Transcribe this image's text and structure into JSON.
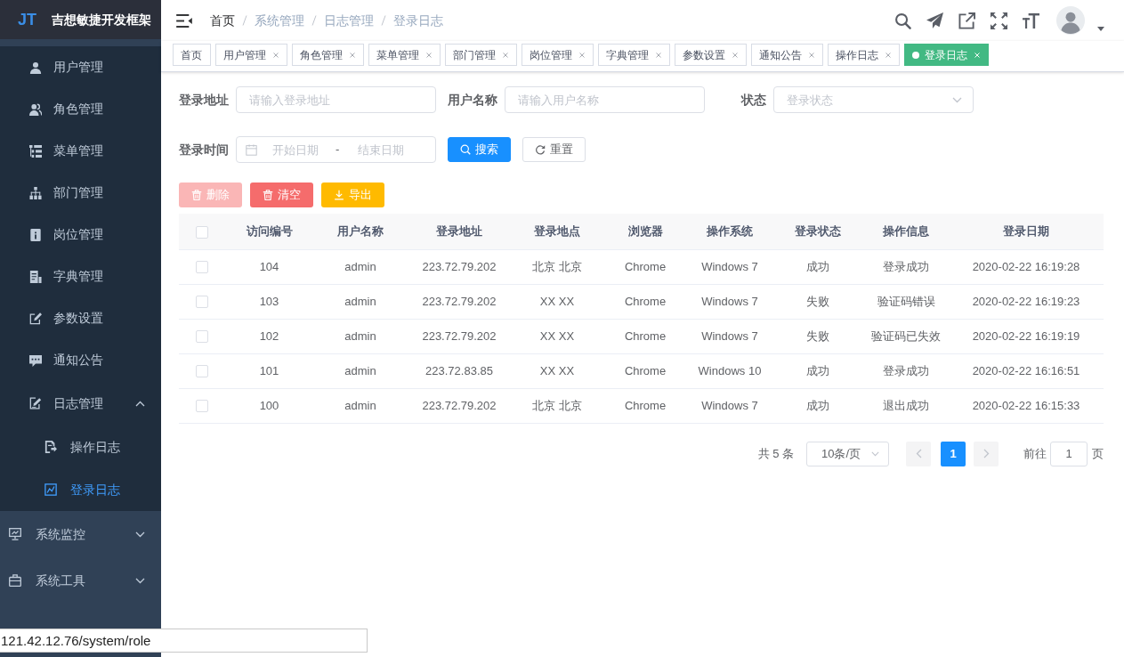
{
  "sidebar": {
    "logo": "JT",
    "title": "吉想敏捷开发框架",
    "submenu_items": [
      {
        "label": "用户管理",
        "kind": "item",
        "selected": false
      },
      {
        "label": "角色管理",
        "kind": "item",
        "selected": false
      },
      {
        "label": "菜单管理",
        "kind": "item",
        "selected": false
      },
      {
        "label": "部门管理",
        "kind": "item",
        "selected": false
      },
      {
        "label": "岗位管理",
        "kind": "item",
        "selected": false
      },
      {
        "label": "字典管理",
        "kind": "item",
        "selected": false
      },
      {
        "label": "参数设置",
        "kind": "item",
        "selected": false
      },
      {
        "label": "通知公告",
        "kind": "item",
        "selected": false
      },
      {
        "label": "日志管理",
        "kind": "group",
        "expanded": true,
        "children": [
          {
            "label": "操作日志",
            "selected": false
          },
          {
            "label": "登录日志",
            "selected": true
          }
        ]
      }
    ],
    "menu_items": [
      {
        "label": "系统监控",
        "expanded": false
      },
      {
        "label": "系统工具",
        "expanded": false
      }
    ]
  },
  "navbar": {
    "breadcrumb": [
      {
        "label": "首页",
        "kind": "link"
      },
      {
        "label": "系统管理",
        "kind": "text"
      },
      {
        "label": "日志管理",
        "kind": "text"
      },
      {
        "label": "登录日志",
        "kind": "text"
      }
    ]
  },
  "tags": [
    {
      "label": "首页",
      "closable": false,
      "selected": false
    },
    {
      "label": "用户管理",
      "closable": true,
      "selected": false
    },
    {
      "label": "角色管理",
      "closable": true,
      "selected": false
    },
    {
      "label": "菜单管理",
      "closable": true,
      "selected": false
    },
    {
      "label": "部门管理",
      "closable": true,
      "selected": false
    },
    {
      "label": "岗位管理",
      "closable": true,
      "selected": false
    },
    {
      "label": "字典管理",
      "closable": true,
      "selected": false
    },
    {
      "label": "参数设置",
      "closable": true,
      "selected": false
    },
    {
      "label": "通知公告",
      "closable": true,
      "selected": false
    },
    {
      "label": "操作日志",
      "closable": true,
      "selected": false
    },
    {
      "label": "登录日志",
      "closable": true,
      "selected": true
    }
  ],
  "search_form": {
    "fields": [
      {
        "label": "登录地址",
        "kind": "input",
        "placeholder": "请输入登录地址"
      },
      {
        "label": "用户名称",
        "kind": "input",
        "placeholder": "请输入用户名称"
      },
      {
        "label": "状态",
        "kind": "select",
        "placeholder": "登录状态"
      },
      {
        "label": "登录时间",
        "kind": "daterange",
        "start_placeholder": "开始日期",
        "separator": "-",
        "end_placeholder": "结束日期"
      }
    ],
    "buttons": [
      {
        "label": "搜索",
        "kind": "primary"
      },
      {
        "label": "重置",
        "kind": "default"
      }
    ]
  },
  "toolbar": [
    {
      "label": "删除",
      "kind": "danger",
      "disabled": true
    },
    {
      "label": "清空",
      "kind": "danger",
      "disabled": false
    },
    {
      "label": "导出",
      "kind": "warning",
      "disabled": false
    }
  ],
  "table": {
    "all_selected": false,
    "columns": [
      "访问编号",
      "用户名称",
      "登录地址",
      "登录地点",
      "浏览器",
      "操作系统",
      "登录状态",
      "操作信息",
      "登录日期"
    ],
    "rows": [
      {
        "selected": false,
        "cells": [
          "104",
          "admin",
          "223.72.79.202",
          "北京 北京",
          "Chrome",
          "Windows 7",
          "成功",
          "登录成功",
          "2020-02-22 16:19:28"
        ]
      },
      {
        "selected": false,
        "cells": [
          "103",
          "admin",
          "223.72.79.202",
          "XX XX",
          "Chrome",
          "Windows 7",
          "失败",
          "验证码错误",
          "2020-02-22 16:19:23"
        ]
      },
      {
        "selected": false,
        "cells": [
          "102",
          "admin",
          "223.72.79.202",
          "XX XX",
          "Chrome",
          "Windows 7",
          "失败",
          "验证码已失效",
          "2020-02-22 16:19:19"
        ]
      },
      {
        "selected": false,
        "cells": [
          "101",
          "admin",
          "223.72.83.85",
          "XX XX",
          "Chrome",
          "Windows 10",
          "成功",
          "登录成功",
          "2020-02-22 16:16:51"
        ]
      },
      {
        "selected": false,
        "cells": [
          "100",
          "admin",
          "223.72.79.202",
          "北京 北京",
          "Chrome",
          "Windows 7",
          "成功",
          "退出成功",
          "2020-02-22 16:15:33"
        ]
      }
    ]
  },
  "pagination": {
    "total": "共 5 条",
    "page_size": "10条/页",
    "prev_disabled": true,
    "pages": [
      {
        "label": "1",
        "selected": true
      }
    ],
    "next_disabled": true,
    "jump_label": "前往",
    "jump_value": "1",
    "jump_suffix": "页"
  },
  "browser_status": {
    "url": "121.42.12.76/system/role"
  }
}
